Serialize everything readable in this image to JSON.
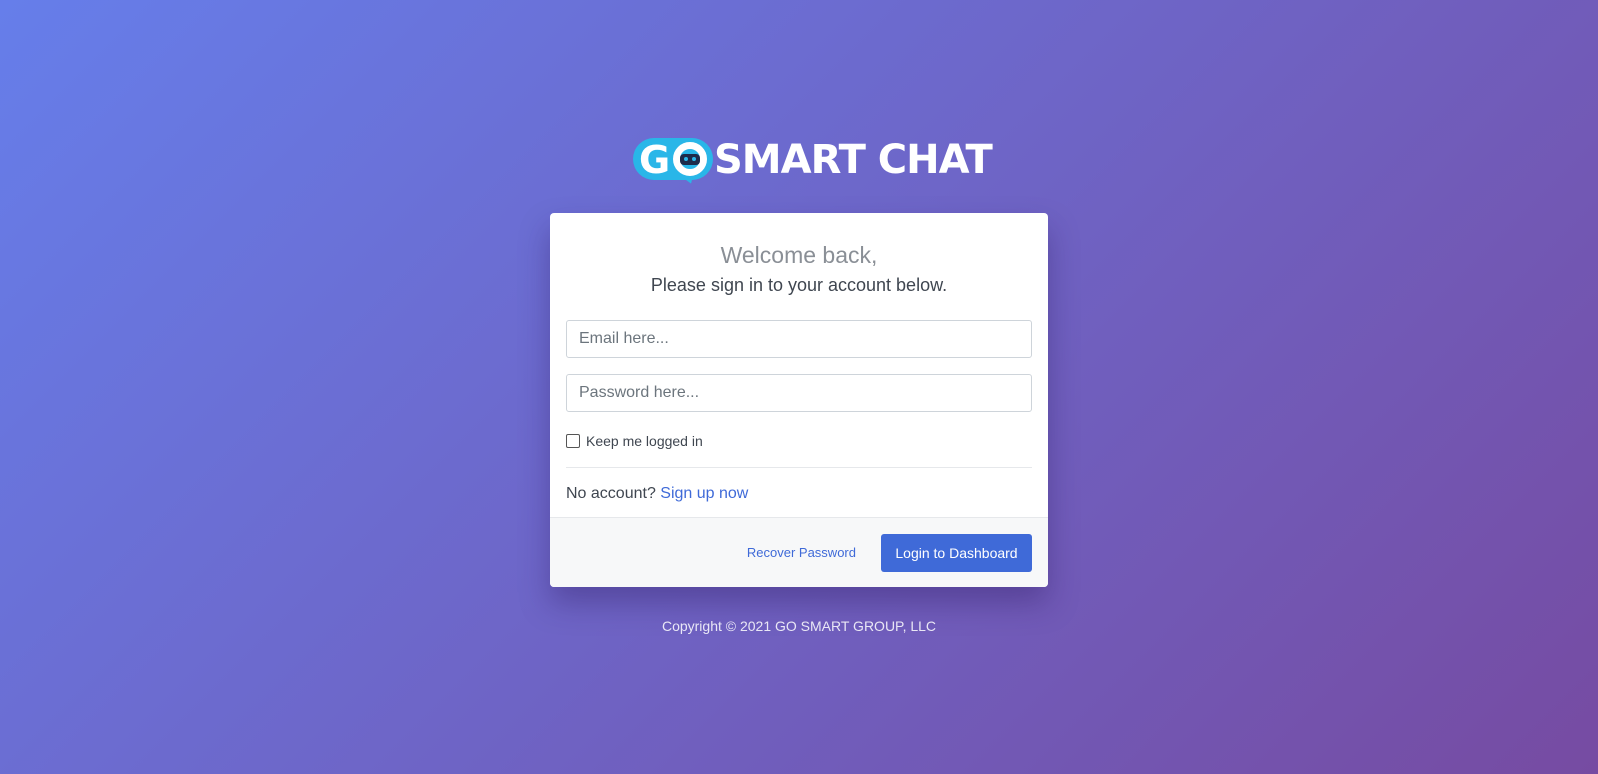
{
  "brand": {
    "logo_text": "SMART CHAT",
    "logo_go": "G"
  },
  "login": {
    "welcome": "Welcome back,",
    "subtitle": "Please sign in to your account below.",
    "email_placeholder": "Email here...",
    "password_placeholder": "Password here...",
    "remember_label": "Keep me logged in",
    "no_account_text": "No account?",
    "signup_link": "Sign up now",
    "recover_link": "Recover Password",
    "login_button": "Login to Dashboard"
  },
  "footer": {
    "copyright": "Copyright © 2021 GO SMART GROUP, LLC"
  },
  "colors": {
    "gradient_start": "#667eea",
    "gradient_end": "#764ba2",
    "accent": "#3f6ad8",
    "logo_blue": "#29b6e8"
  }
}
